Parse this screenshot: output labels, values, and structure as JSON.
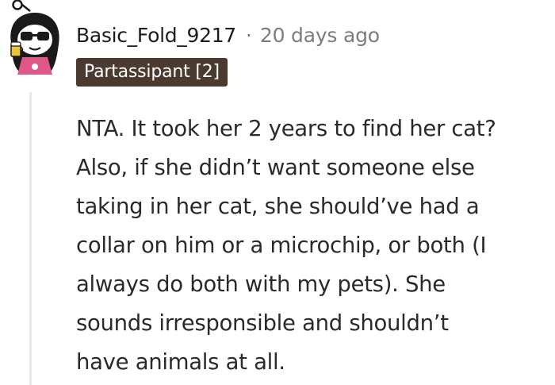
{
  "comment": {
    "username": "Basic_Fold_9217",
    "separator": "·",
    "timestamp": "20 days ago",
    "flair": "Partassipant [2]",
    "body_lines": [
      "NTA. It took her 2 years to find her cat?",
      "Also, if she didn’t want someone else",
      "taking in her cat, she should’ve had a",
      "collar on him or a microchip, or both (I",
      "always do both with my pets). She",
      "sounds irresponsible and shouldn’t",
      "have animals at all."
    ]
  },
  "avatar": {
    "icon": "snoo-avatar-with-sunglasses-icon"
  },
  "colors": {
    "flair_bg": "#4a3a30",
    "muted_text": "#7c7c7c",
    "thread_line": "#e9e9e9"
  }
}
